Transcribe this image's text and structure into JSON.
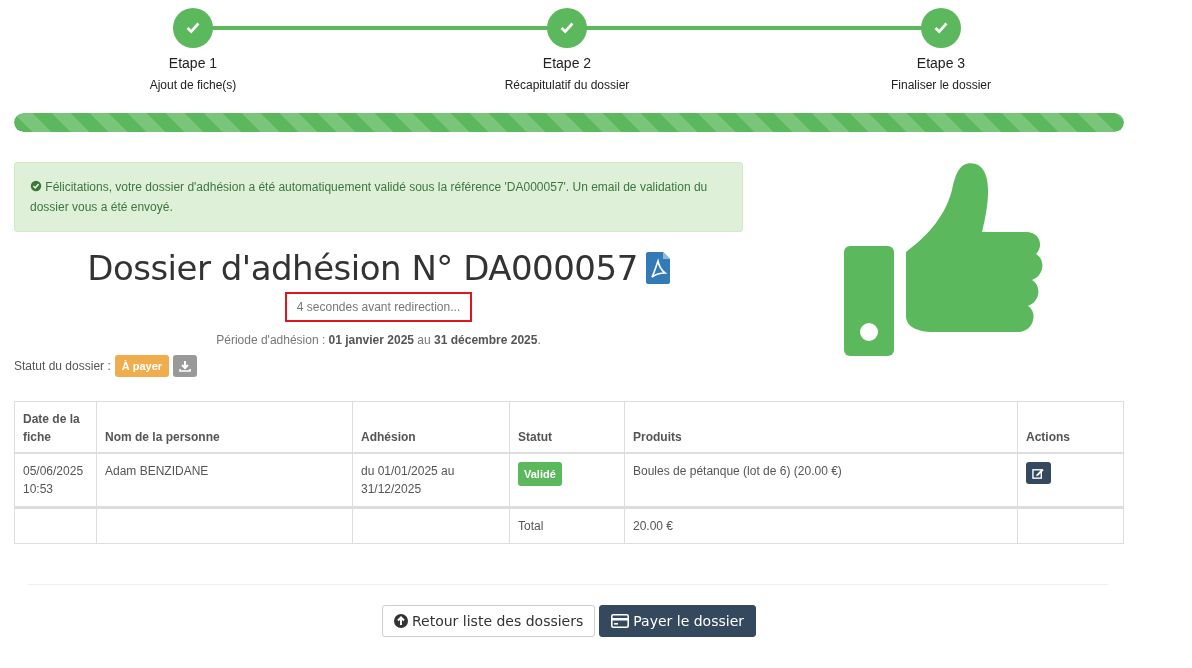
{
  "steps": [
    {
      "title": "Etape 1",
      "subtitle": "Ajout de fiche(s)",
      "done": true
    },
    {
      "title": "Etape 2",
      "subtitle": "Récapitulatif du dossier",
      "done": true
    },
    {
      "title": "Etape 3",
      "subtitle": "Finaliser le dossier",
      "done": true
    }
  ],
  "progress": {
    "level": 1
  },
  "alert": {
    "message": "Félicitations, votre dossier d'adhésion a été automatiquement validé sous la référence 'DA000057'. Un email de validation du dossier vous a été envoyé."
  },
  "heading": {
    "title": "Dossier d'adhésion N° DA000057",
    "redirect": "4 secondes avant redirection...",
    "period": "Période d'adhésion : **01 janvier 2025** au **31 décembre 2025**."
  },
  "dossier_status": {
    "label": "Statut du dossier :",
    "badge": {
      "text": "À payer",
      "color": "#f0ad4e"
    }
  },
  "table": {
    "columns": [
      "Date de la fiche",
      "Nom de la personne",
      "Adhésion",
      "Statut",
      "Produits",
      "Actions"
    ],
    "rows": [
      {
        "date": "05/06/2025 10:53",
        "name": "Adam BENZIDANE",
        "period": "du 01/01/2025 au 31/12/2025",
        "status": {
          "text": "Validé",
          "color": "#5cb85c"
        },
        "products": "Boules de pétanque (lot de 6) (20.00 €)"
      }
    ],
    "total": {
      "label": "Total",
      "amount": "20.00 €"
    }
  },
  "buttons": [
    {
      "label": "Retour liste des dossiers",
      "kind": "back"
    },
    {
      "label": "Payer le dossier",
      "kind": "pay"
    }
  ]
}
